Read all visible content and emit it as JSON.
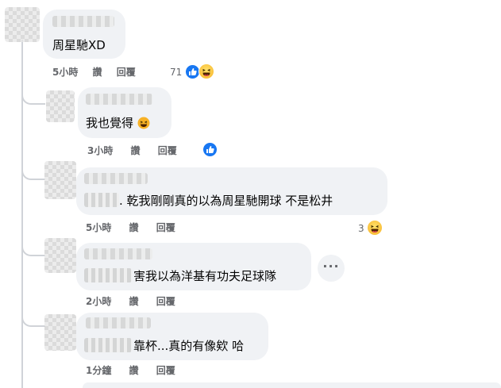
{
  "comment_thread": {
    "parent": {
      "text": "周星馳XD",
      "time": "5小時",
      "like_label": "讚",
      "reply_label": "回覆",
      "reaction_count": "71"
    },
    "replies": [
      {
        "text": "我也覺得",
        "time": "3小時",
        "like_label": "讚",
        "reply_label": "回覆"
      },
      {
        "text": ". 乾我剛剛真的以為周星馳開球 不是松井",
        "time": "5小時",
        "like_label": "讚",
        "reply_label": "回覆",
        "reaction_count": "3"
      },
      {
        "text": "害我以為洋基有功夫足球隊",
        "time": "2小時",
        "like_label": "讚",
        "reply_label": "回覆",
        "more_label": "···"
      },
      {
        "text": "靠杯...真的有像欸 哈",
        "time": "1分鐘",
        "like_label": "讚",
        "reply_label": "回覆"
      }
    ]
  },
  "colors": {
    "bubble": "#f0f2f5",
    "meta_text": "#65676b",
    "like_blue": "#1877f2",
    "haha_yellow": "#f7b125"
  },
  "icons": [
    "like-icon",
    "haha-icon",
    "grin-emoji-icon",
    "more-options-icon"
  ]
}
